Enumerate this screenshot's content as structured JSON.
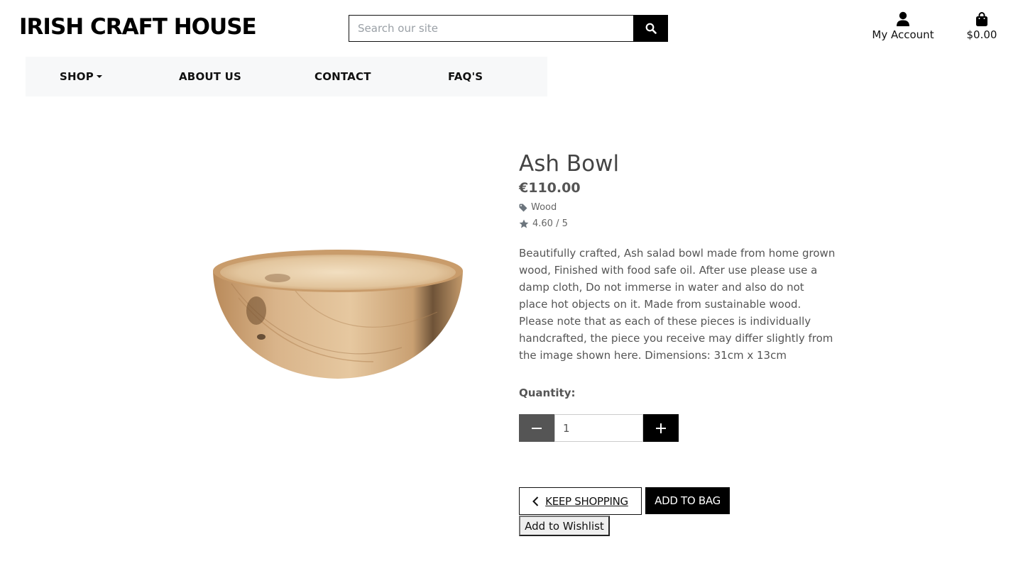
{
  "header": {
    "brand": "IRISH CRAFT HOUSE",
    "search_placeholder": "Search our site",
    "search_icon": "search-icon",
    "account_label": "My Account",
    "account_icon": "user-icon",
    "cart_total": "$0.00",
    "cart_icon": "shopping-bag-icon"
  },
  "nav": {
    "items": [
      {
        "label": "SHOP",
        "has_dropdown": true
      },
      {
        "label": "ABOUT US"
      },
      {
        "label": "CONTACT"
      },
      {
        "label": "FAQ'S"
      }
    ]
  },
  "product": {
    "name": "Ash Bowl",
    "price": "€110.00",
    "category": "Wood",
    "category_icon": "tag-icon",
    "rating": "4.60 / 5",
    "rating_icon": "star-icon",
    "description": "Beautifully crafted, Ash salad bowl made from home grown wood, Finished with food safe oil. After use please use a damp cloth, Do not immerse in water and also do not place hot objects on it. Made from sustainable wood. Please note that as each of these pieces is individually handcrafted, the piece you receive may differ slightly from the image shown here. Dimensions: 31cm x 13cm",
    "image": "wooden-bowl-photo"
  },
  "purchase": {
    "quantity_label": "Quantity:",
    "quantity_value": "1",
    "keep_shopping_label": "KEEP SHOPPING",
    "add_to_bag_label": "ADD TO BAG",
    "wishlist_label": "Add to Wishlist"
  },
  "colors": {
    "primary": "#000000",
    "decrement_bg": "#555555",
    "nav_bg": "#f7f8f9"
  }
}
